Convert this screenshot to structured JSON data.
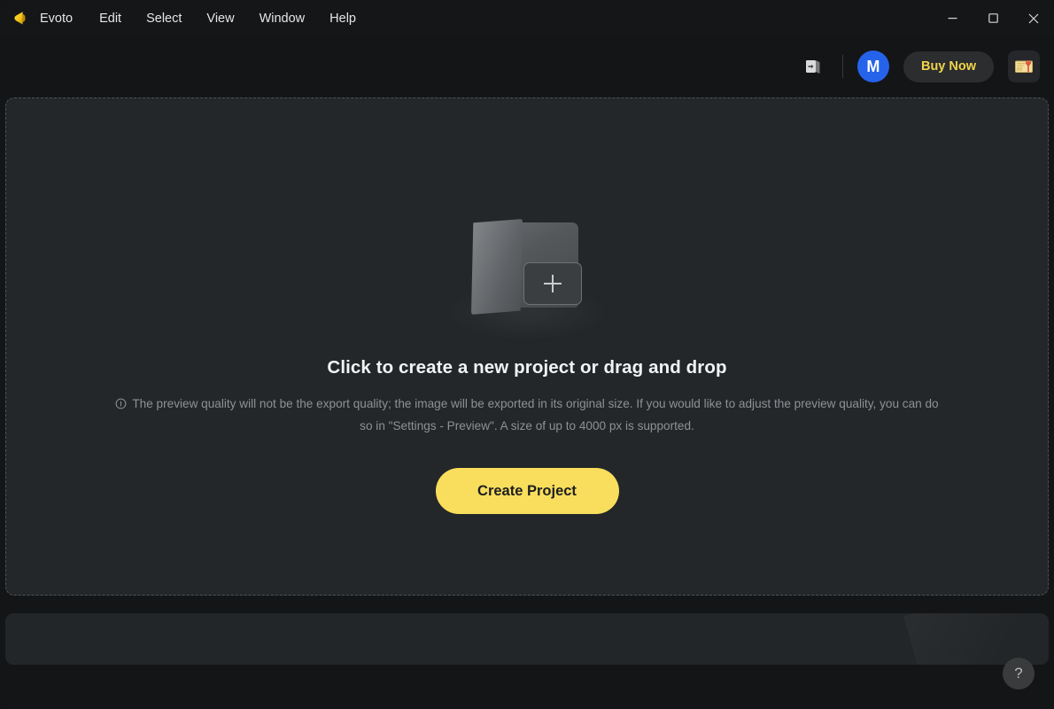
{
  "window": {
    "app_name": "Evoto",
    "logo_icon": "evoto-logo-icon",
    "controls": {
      "minimize": "minimize-icon",
      "maximize": "maximize-icon",
      "close": "close-icon"
    }
  },
  "menubar": {
    "items": [
      {
        "label": "Evoto"
      },
      {
        "label": "Edit"
      },
      {
        "label": "Select"
      },
      {
        "label": "View"
      },
      {
        "label": "Window"
      },
      {
        "label": "Help"
      }
    ]
  },
  "toolbar": {
    "import_icon": "sign-in-icon",
    "avatar_initial": "M",
    "avatar_color": "#2563eb",
    "buy_now_label": "Buy Now",
    "buy_now_text_color": "#f0d44a",
    "gift_icon": "gift-card-icon"
  },
  "dropzone": {
    "folder_icon": "folder-add-icon",
    "title": "Click to create a new project or drag and drop",
    "info_icon": "info-circle-icon",
    "description": "The preview quality will not be the export quality; the image will be exported in its original size. If you would like to adjust the preview quality, you can do so in \"Settings - Preview\". A size of up to 4000 px is supported.",
    "create_button_label": "Create Project",
    "create_button_color": "#f8de5c"
  },
  "bottom": {
    "help_label": "?"
  }
}
